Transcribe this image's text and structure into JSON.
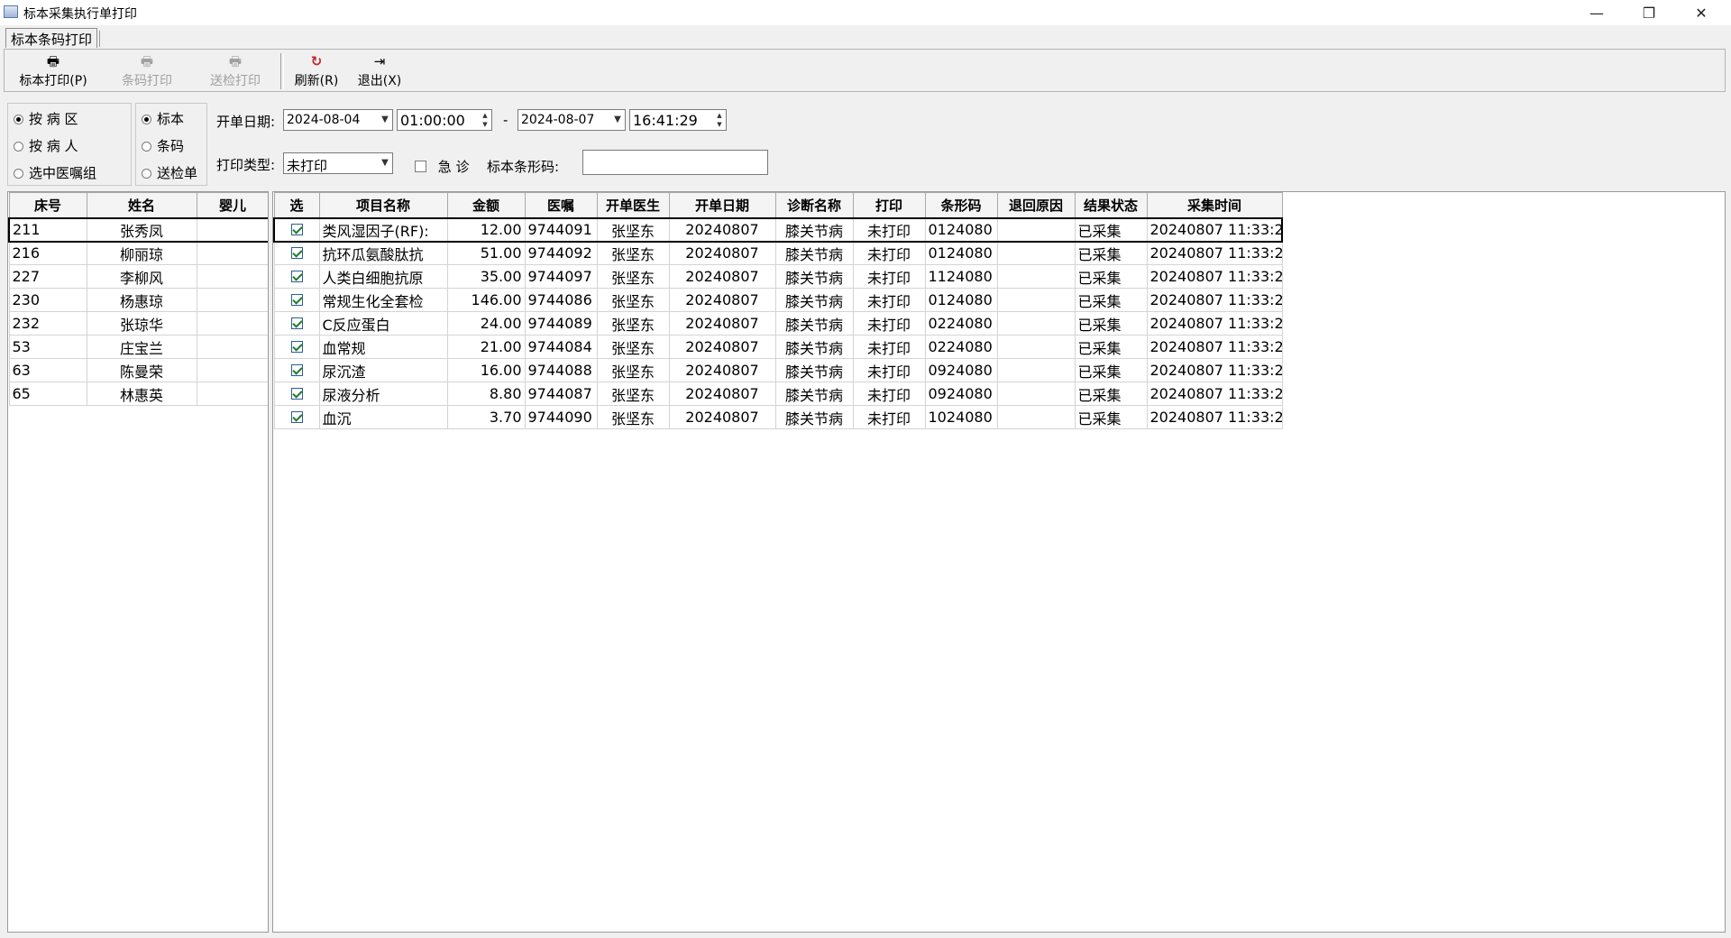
{
  "window": {
    "title": "标本采集执行单打印",
    "minimize": "—",
    "maximize": "❐",
    "close": "✕"
  },
  "tab": {
    "label": "标本条码打印"
  },
  "toolbar": {
    "buttons": [
      {
        "label": "标本打印(P)",
        "icon": "printer-icon",
        "enabled": true
      },
      {
        "label": "条码打印",
        "icon": "printer-icon",
        "enabled": false
      },
      {
        "label": "送检打印",
        "icon": "printer-icon",
        "enabled": false
      },
      {
        "label": "刷新(R)",
        "icon": "refresh-icon",
        "enabled": true
      },
      {
        "label": "退出(X)",
        "icon": "exit-icon",
        "enabled": true
      }
    ]
  },
  "filters": {
    "mode_options": [
      {
        "label": "按 病 区",
        "selected": true
      },
      {
        "label": "按 病 人",
        "selected": false
      },
      {
        "label": "选中医嘱组",
        "selected": false
      }
    ],
    "print_options": [
      {
        "label": "标本",
        "selected": true
      },
      {
        "label": "条码",
        "selected": false
      },
      {
        "label": "送检单",
        "selected": false
      }
    ],
    "order_date_label": "开单日期:",
    "start_date": "2024-08-04",
    "start_time": "01:00:00",
    "range_sep": "-",
    "end_date": "2024-08-07",
    "end_time": "16:41:29",
    "print_type_label": "打印类型:",
    "print_type_value": "未打印",
    "urgent_label": "急 诊",
    "urgent_checked": false,
    "barcode_label": "标本条形码:",
    "barcode_value": ""
  },
  "patients": {
    "columns": [
      "床号",
      "姓名",
      "婴儿"
    ],
    "rows": [
      {
        "bed": "211",
        "name": "张秀凤",
        "baby": ""
      },
      {
        "bed": "216",
        "name": "柳丽琼",
        "baby": ""
      },
      {
        "bed": "227",
        "name": "李柳风",
        "baby": ""
      },
      {
        "bed": "230",
        "name": "杨惠琼",
        "baby": ""
      },
      {
        "bed": "232",
        "name": "张琼华",
        "baby": ""
      },
      {
        "bed": "53",
        "name": "庄宝兰",
        "baby": ""
      },
      {
        "bed": "63",
        "name": "陈曼荣",
        "baby": ""
      },
      {
        "bed": "65",
        "name": "林惠英",
        "baby": ""
      }
    ]
  },
  "orders": {
    "columns": [
      "选",
      "项目名称",
      "金额",
      "医嘱",
      "开单医生",
      "开单日期",
      "诊断名称",
      "打印",
      "条形码",
      "退回原因",
      "结果状态",
      "采集时间"
    ],
    "rows": [
      {
        "checked": true,
        "item": "类风湿因子(RF):",
        "amount": "12.00",
        "order": "9744091",
        "doctor": "张坚东",
        "date": "20240807",
        "diagnosis": "膝关节病",
        "print": "未打印",
        "barcode": "0124080",
        "reason": "",
        "status": "已采集",
        "time": "20240807 11:33:2"
      },
      {
        "checked": true,
        "item": "抗环瓜氨酸肽抗",
        "amount": "51.00",
        "order": "9744092",
        "doctor": "张坚东",
        "date": "20240807",
        "diagnosis": "膝关节病",
        "print": "未打印",
        "barcode": "0124080",
        "reason": "",
        "status": "已采集",
        "time": "20240807 11:33:2"
      },
      {
        "checked": true,
        "item": "人类白细胞抗原",
        "amount": "35.00",
        "order": "9744097",
        "doctor": "张坚东",
        "date": "20240807",
        "diagnosis": "膝关节病",
        "print": "未打印",
        "barcode": "1124080",
        "reason": "",
        "status": "已采集",
        "time": "20240807 11:33:2"
      },
      {
        "checked": true,
        "item": "常规生化全套检",
        "amount": "146.00",
        "order": "9744086",
        "doctor": "张坚东",
        "date": "20240807",
        "diagnosis": "膝关节病",
        "print": "未打印",
        "barcode": "0124080",
        "reason": "",
        "status": "已采集",
        "time": "20240807 11:33:2"
      },
      {
        "checked": true,
        "item": "C反应蛋白",
        "amount": "24.00",
        "order": "9744089",
        "doctor": "张坚东",
        "date": "20240807",
        "diagnosis": "膝关节病",
        "print": "未打印",
        "barcode": "0224080",
        "reason": "",
        "status": "已采集",
        "time": "20240807 11:33:2"
      },
      {
        "checked": true,
        "item": "血常规",
        "amount": "21.00",
        "order": "9744084",
        "doctor": "张坚东",
        "date": "20240807",
        "diagnosis": "膝关节病",
        "print": "未打印",
        "barcode": "0224080",
        "reason": "",
        "status": "已采集",
        "time": "20240807 11:33:2"
      },
      {
        "checked": true,
        "item": "尿沉渣",
        "amount": "16.00",
        "order": "9744088",
        "doctor": "张坚东",
        "date": "20240807",
        "diagnosis": "膝关节病",
        "print": "未打印",
        "barcode": "0924080",
        "reason": "",
        "status": "已采集",
        "time": "20240807 11:33:2"
      },
      {
        "checked": true,
        "item": "尿液分析",
        "amount": "8.80",
        "order": "9744087",
        "doctor": "张坚东",
        "date": "20240807",
        "diagnosis": "膝关节病",
        "print": "未打印",
        "barcode": "0924080",
        "reason": "",
        "status": "已采集",
        "time": "20240807 11:33:2"
      },
      {
        "checked": true,
        "item": "血沉",
        "amount": "3.70",
        "order": "9744090",
        "doctor": "张坚东",
        "date": "20240807",
        "diagnosis": "膝关节病",
        "print": "未打印",
        "barcode": "1024080",
        "reason": "",
        "status": "已采集",
        "time": "20240807 11:33:2"
      }
    ]
  }
}
